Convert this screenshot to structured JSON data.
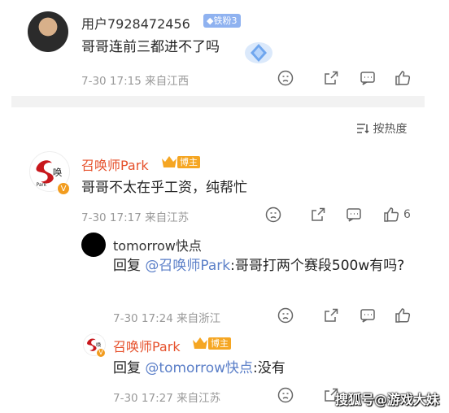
{
  "comment1": {
    "username": "用户7928472456",
    "fan_badge": "铁粉3",
    "text": "哥哥连前三都进不了吗",
    "meta": "7-30 17:15  来自江西"
  },
  "sort_label": "按热度",
  "comment2": {
    "username": "召唤师Park",
    "host_badge": "博主",
    "text": "哥哥不太在乎工资，纯帮忙",
    "meta": "7-30 17:17  来自江苏",
    "like_count": "6"
  },
  "reply1": {
    "username": "tomorrow快点",
    "reply_prefix": "回复",
    "mention": "@召唤师Park",
    "text": ":哥哥打两个赛段500w有吗?",
    "meta": "7-30 17:24  来自浙江"
  },
  "reply2": {
    "username": "召唤师Park",
    "host_badge": "博主",
    "reply_prefix": "回复",
    "mention": "@tomorrow快点",
    "text": ":没有",
    "meta": "7-30 17:27  来自江苏"
  },
  "watermark": "搜狐号@游戏大妹",
  "icons": [
    "emoji-icon",
    "share-icon",
    "comment-icon",
    "like-icon",
    "sort-icon",
    "crown-icon",
    "verified-icon",
    "diamond-sticker-icon"
  ],
  "colors": {
    "username_accent": "#e6512c",
    "link": "#5b7fc8",
    "fan_badge": "#8fb2f0",
    "host_badge": "#f5a623"
  }
}
